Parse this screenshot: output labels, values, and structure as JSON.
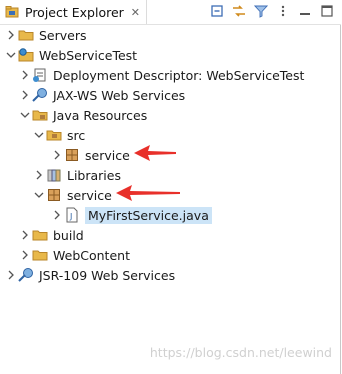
{
  "view": {
    "title": "Project Explorer",
    "close_symbol": "✕",
    "toolbar": [
      "collapse-all-icon",
      "link-with-editor-icon",
      "filter-icon",
      "view-menu-icon",
      "minimize-icon",
      "maximize-icon"
    ]
  },
  "tree": {
    "servers": "Servers",
    "project": "WebServiceTest",
    "deployment": "Deployment Descriptor: WebServiceTest",
    "jaxws": "JAX-WS Web Services",
    "java_resources": "Java Resources",
    "src": "src",
    "src_service": "service",
    "libraries": "Libraries",
    "service_pkg": "service",
    "java_file": "MyFirstService.java",
    "build": "build",
    "webcontent": "WebContent",
    "jsr": "JSR-109 Web Services"
  },
  "watermark": "https://blog.csdn.net/leewind",
  "colors": {
    "arrow": "#e8302a",
    "selection": "#cce4f7",
    "folder": "#e8b84a",
    "package": "#b07c3c"
  }
}
